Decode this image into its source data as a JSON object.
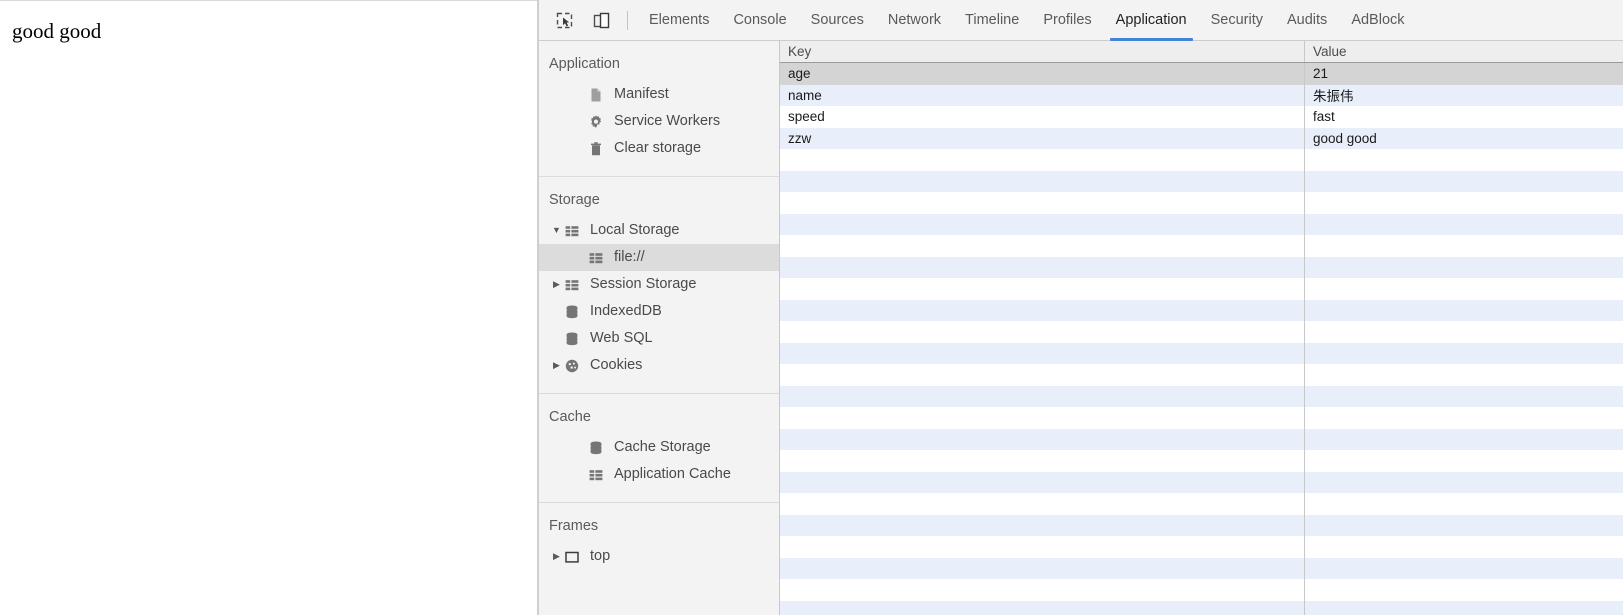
{
  "page": {
    "content_text": "good good"
  },
  "devtools": {
    "toolbar": {
      "inspect_icon": "inspect-element-icon",
      "device_icon": "device-toolbar-icon"
    },
    "tabs": [
      {
        "label": "Elements",
        "active": false
      },
      {
        "label": "Console",
        "active": false
      },
      {
        "label": "Sources",
        "active": false
      },
      {
        "label": "Network",
        "active": false
      },
      {
        "label": "Timeline",
        "active": false
      },
      {
        "label": "Profiles",
        "active": false
      },
      {
        "label": "Application",
        "active": true
      },
      {
        "label": "Security",
        "active": false
      },
      {
        "label": "Audits",
        "active": false
      },
      {
        "label": "AdBlock",
        "active": false
      }
    ],
    "active_tab": "Application",
    "accent_color": "#4285d6",
    "sidebar": {
      "sections": [
        {
          "title": "Application",
          "items": [
            {
              "label": "Manifest",
              "icon": "manifest-file-icon",
              "indent": 2,
              "twisty": "none",
              "selected": false
            },
            {
              "label": "Service Workers",
              "icon": "gear-icon",
              "indent": 2,
              "twisty": "none",
              "selected": false
            },
            {
              "label": "Clear storage",
              "icon": "trash-icon",
              "indent": 2,
              "twisty": "none",
              "selected": false
            }
          ]
        },
        {
          "title": "Storage",
          "items": [
            {
              "label": "Local Storage",
              "icon": "table-grid-icon",
              "indent": 1,
              "twisty": "expanded",
              "selected": false
            },
            {
              "label": "file://",
              "icon": "table-grid-icon",
              "indent": 2,
              "twisty": "none",
              "selected": true
            },
            {
              "label": "Session Storage",
              "icon": "table-grid-icon",
              "indent": 1,
              "twisty": "collapsed",
              "selected": false
            },
            {
              "label": "IndexedDB",
              "icon": "database-icon",
              "indent": 1,
              "twisty": "none",
              "selected": false
            },
            {
              "label": "Web SQL",
              "icon": "database-icon",
              "indent": 1,
              "twisty": "none",
              "selected": false
            },
            {
              "label": "Cookies",
              "icon": "cookie-icon",
              "indent": 1,
              "twisty": "collapsed",
              "selected": false
            }
          ]
        },
        {
          "title": "Cache",
          "items": [
            {
              "label": "Cache Storage",
              "icon": "database-icon",
              "indent": 2,
              "twisty": "none",
              "selected": false
            },
            {
              "label": "Application Cache",
              "icon": "table-grid-icon",
              "indent": 2,
              "twisty": "none",
              "selected": false
            }
          ]
        },
        {
          "title": "Frames",
          "items": [
            {
              "label": "top",
              "icon": "frame-icon",
              "indent": 1,
              "twisty": "collapsed",
              "selected": false
            }
          ]
        }
      ]
    },
    "storage_table": {
      "columns": [
        "Key",
        "Value"
      ],
      "rows": [
        {
          "key": "age",
          "value": "21",
          "selected": true
        },
        {
          "key": "name",
          "value": "朱振伟",
          "selected": false
        },
        {
          "key": "speed",
          "value": "fast",
          "selected": false
        },
        {
          "key": "zzw",
          "value": "good good",
          "selected": false
        }
      ],
      "empty_row_count": 22,
      "selected_row_background": "#d4d4d4",
      "stripe_color": "#e8eefa"
    }
  }
}
